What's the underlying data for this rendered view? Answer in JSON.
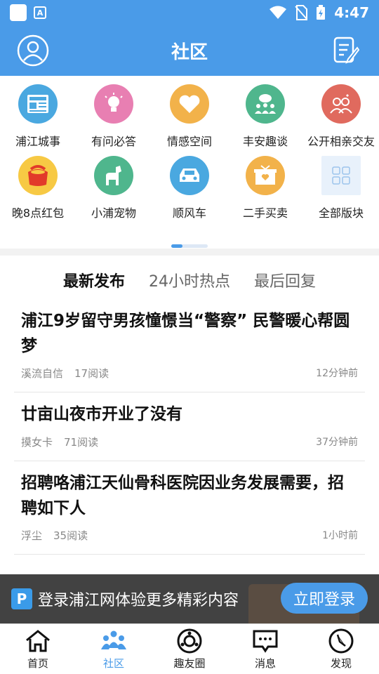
{
  "status_bar": {
    "time": "4:47",
    "app_badge": "A"
  },
  "header": {
    "title": "社区"
  },
  "categories": [
    {
      "label": "浦江城事",
      "icon": "news-icon",
      "color": "#4aa8e0"
    },
    {
      "label": "有问必答",
      "icon": "lightbulb-icon",
      "color": "#e87fb2"
    },
    {
      "label": "情感空间",
      "icon": "heart-icon",
      "color": "#f2b24a"
    },
    {
      "label": "丰安趣谈",
      "icon": "chat-people-icon",
      "color": "#4fb68d"
    },
    {
      "label": "公开相亲交友",
      "icon": "couple-icon",
      "color": "#e06a5e"
    },
    {
      "label": "晚8点红包",
      "icon": "red-envelope-icon",
      "color": "#f7c944"
    },
    {
      "label": "小浦宠物",
      "icon": "dog-icon",
      "color": "#4fb68d"
    },
    {
      "label": "顺风车",
      "icon": "car-icon",
      "color": "#4aa8e0"
    },
    {
      "label": "二手买卖",
      "icon": "gift-box-icon",
      "color": "#f2b24a"
    },
    {
      "label": "全部版块",
      "icon": "grid-icon",
      "color": "#e8f1fb"
    }
  ],
  "tabs": [
    {
      "label": "最新发布",
      "active": true
    },
    {
      "label": "24小时热点",
      "active": false
    },
    {
      "label": "最后回复",
      "active": false
    }
  ],
  "posts": [
    {
      "title": "浦江9岁留守男孩憧憬当“警察” 民警暖心帮圆梦",
      "author": "溪流自信",
      "reads": "17阅读",
      "time": "12分钟前"
    },
    {
      "title": "廿亩山夜市开业了没有",
      "author": "摸女卡",
      "reads": "71阅读",
      "time": "37分钟前"
    },
    {
      "title": "招聘咯浦江天仙骨科医院因业务发展需要，招聘如下人",
      "author": "浮尘",
      "reads": "35阅读",
      "time": "1小时前"
    }
  ],
  "banner": {
    "logo": "P",
    "text": "登录浦江网体验更多精彩内容",
    "button": "立即登录"
  },
  "bottom_nav": [
    {
      "label": "首页",
      "icon": "home-icon",
      "active": false
    },
    {
      "label": "社区",
      "icon": "community-icon",
      "active": true
    },
    {
      "label": "趣友圈",
      "icon": "circle-friends-icon",
      "active": false
    },
    {
      "label": "消息",
      "icon": "message-icon",
      "active": false
    },
    {
      "label": "发现",
      "icon": "compass-icon",
      "active": false
    }
  ],
  "colors": {
    "primary": "#4a9be8"
  }
}
